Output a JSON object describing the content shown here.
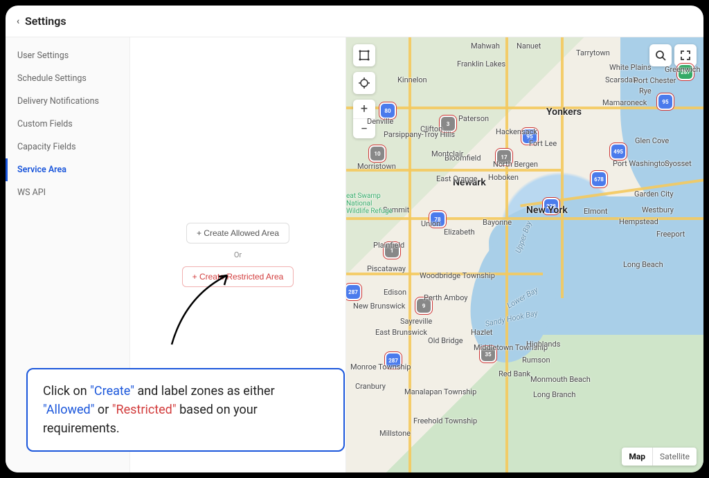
{
  "header": {
    "title": "Settings"
  },
  "sidebar": {
    "items": [
      {
        "label": "User Settings"
      },
      {
        "label": "Schedule Settings"
      },
      {
        "label": "Delivery Notifications"
      },
      {
        "label": "Custom Fields"
      },
      {
        "label": "Capacity Fields"
      },
      {
        "label": "Service Area",
        "active": true
      },
      {
        "label": "WS API"
      }
    ]
  },
  "panel": {
    "create_allowed": "+ Create Allowed Area",
    "or": "Or",
    "create_restricted": "+ Create Restricted Area"
  },
  "callout": {
    "pre": "Click on ",
    "create": "\"Create\"",
    "mid1": " and label zones as either ",
    "allowed": "\"Allowed\"",
    "or": " or ",
    "restricted": "\"Restricted\"",
    "post": " based on your requirements."
  },
  "map": {
    "type_map": "Map",
    "type_sat": "Satellite",
    "labels": {
      "new_york": "New York",
      "yonkers": "Yonkers",
      "newark": "Newark",
      "paterson": "Paterson",
      "hoboken": "Hoboken",
      "hackensack": "Hackensack",
      "fort_lee": "Fort Lee",
      "north_bergen": "North Bergen",
      "bloomfield": "Bloomfield",
      "montclair": "Montclair",
      "east_orange": "East Orange",
      "clifton": "Clifton",
      "parsippany": "Parsippany-Troy Hills",
      "morristown": "Morristown",
      "summit": "Summit",
      "union": "Union",
      "elizabeth": "Elizabeth",
      "bayonne": "Bayonne",
      "plainfield": "Plainfield",
      "piscataway": "Piscataway",
      "edison": "Edison",
      "new_brunswick": "New Brunswick",
      "woodbridge": "Woodbridge Township",
      "perth_amboy": "Perth Amboy",
      "sayreville": "Sayreville",
      "east_brunswick": "East Brunswick",
      "old_bridge": "Old Bridge",
      "hazlet": "Hazlet",
      "middletown": "Middletown Township",
      "red_bank": "Red Bank",
      "monmouth_beach": "Monmouth Beach",
      "long_branch": "Long Branch",
      "highlands": "Highlands",
      "rumson": "Rumson",
      "freehold": "Freehold Township",
      "manalapan": "Manalapan Township",
      "monroe": "Monroe Township",
      "cranbury": "Cranbury",
      "millstone": "Millstone",
      "mahwah": "Mahwah",
      "nanuet": "Nanuet",
      "tarrytown": "Tarrytown",
      "white_plains": "White Plains",
      "scarsdale": "Scarsdale",
      "port_chester": "Port Chester",
      "rye": "Rye",
      "mamaroneck": "Mamaroneck",
      "greenwich": "Greenwich",
      "glen_cove": "Glen Cove",
      "port_washington": "Port Washington",
      "syosset": "Syosset",
      "westbury": "Westbury",
      "garden_city": "Garden City",
      "elmont": "Elmont",
      "hempstead": "Hempstead",
      "freeport": "Freeport",
      "long_beach": "Long Beach",
      "franklin_lakes": "Franklin Lakes",
      "kinnelon": "Kinnelon",
      "denville": "Denville",
      "great_swamp": "eat Swamp National Wildlife Refuge",
      "upper_bay": "Upper Bay",
      "lower_bay": "Lower Bay",
      "sandy_hook": "Sandy Hook Bay"
    },
    "shields": {
      "i80": "80",
      "i78": "78",
      "i95a": "95",
      "i95b": "95",
      "i278": "278",
      "i287a": "287",
      "i287b": "287",
      "i495": "495",
      "i678": "678",
      "i287c": "287",
      "r10": "10",
      "r3": "3",
      "r17": "17",
      "r9": "9",
      "r35": "35",
      "r1": "1"
    }
  }
}
